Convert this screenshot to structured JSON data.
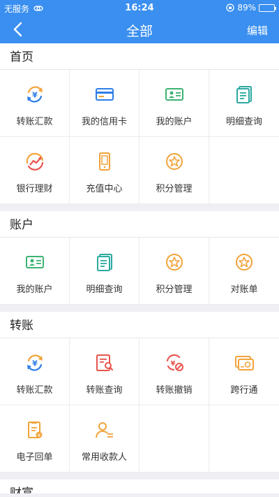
{
  "statusbar": {
    "carrier": "无服务",
    "time": "16:24",
    "battery": "89%",
    "battery_level": 0.89
  },
  "nav": {
    "title": "全部",
    "edit": "编辑"
  },
  "sections": [
    {
      "title": "首页",
      "items": [
        {
          "label": "转账汇款",
          "icon": "transfer-icon"
        },
        {
          "label": "我的信用卡",
          "icon": "credit-card-icon"
        },
        {
          "label": "我的账户",
          "icon": "account-card-icon"
        },
        {
          "label": "明细查询",
          "icon": "detail-doc-icon"
        },
        {
          "label": "银行理财",
          "icon": "finance-chart-icon"
        },
        {
          "label": "充值中心",
          "icon": "phone-recharge-icon"
        },
        {
          "label": "积分管理",
          "icon": "points-star-icon"
        }
      ]
    },
    {
      "title": "账户",
      "items": [
        {
          "label": "我的账户",
          "icon": "account-card-icon"
        },
        {
          "label": "明细查询",
          "icon": "detail-doc-icon"
        },
        {
          "label": "积分管理",
          "icon": "points-star-icon"
        },
        {
          "label": "对账单",
          "icon": "statement-star-icon"
        }
      ]
    },
    {
      "title": "转账",
      "items": [
        {
          "label": "转账汇款",
          "icon": "transfer-icon"
        },
        {
          "label": "转账查询",
          "icon": "transfer-search-icon"
        },
        {
          "label": "转账撤销",
          "icon": "transfer-cancel-icon"
        },
        {
          "label": "跨行通",
          "icon": "interbank-card-icon"
        },
        {
          "label": "电子回单",
          "icon": "receipt-icon"
        },
        {
          "label": "常用收款人",
          "icon": "payee-icon"
        }
      ]
    },
    {
      "title": "财富"
    }
  ],
  "colors": {
    "primary": "#3a8ff0",
    "green": "#3cb371",
    "teal": "#2aa9a0",
    "orange": "#f2a33a",
    "red": "#e8554e",
    "blue": "#2d7ee8"
  }
}
